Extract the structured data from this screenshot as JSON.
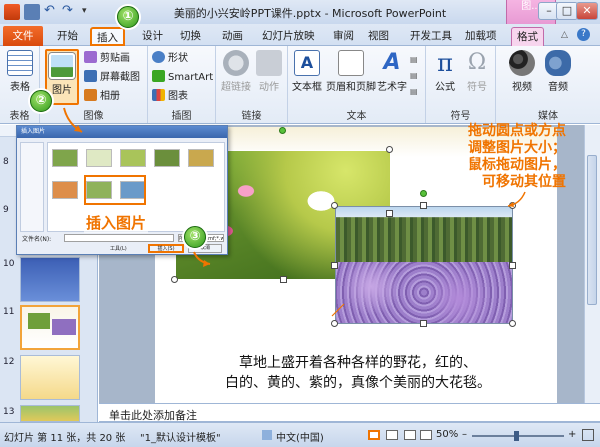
{
  "window": {
    "title": "美丽的小兴安岭PPT课件.pptx - Microsoft PowerPoint",
    "context_group": "图...",
    "minimize": "–",
    "maximize": "□",
    "close": "✕"
  },
  "tabs": {
    "file": "文件",
    "items": [
      "开始",
      "插入",
      "设计",
      "切换",
      "动画",
      "幻灯片放映",
      "审阅",
      "视图",
      "开发工具",
      "加载项"
    ],
    "format": "格式"
  },
  "ribbon": {
    "table_group": {
      "label": "表格",
      "table_btn": "表格"
    },
    "image_group": {
      "label": "图像",
      "picture_btn": "图片",
      "clipart_btn": "剪贴画",
      "screenshot_btn": "屏幕截图",
      "album_btn": "相册"
    },
    "illustration_group": {
      "label": "插图",
      "shapes_btn": "形状",
      "smartart_btn": "SmartArt",
      "chart_btn": "图表"
    },
    "links_group": {
      "label": "链接",
      "hyperlink_btn": "超链接",
      "action_btn": "动作"
    },
    "text_group": {
      "label": "文本",
      "textbox_btn": "文本框",
      "header_btn": "页眉和页脚",
      "wordart_btn": "艺术字",
      "more_btn": ""
    },
    "symbol_group": {
      "label": "符号",
      "formula_btn": "公式",
      "symbol_btn": "符号"
    },
    "media_group": {
      "label": "媒体",
      "video_btn": "视频",
      "audio_btn": "音频"
    }
  },
  "slides": {
    "numbers": [
      "8",
      "9",
      "10",
      "11",
      "12",
      "13"
    ]
  },
  "dialog": {
    "title": "插入图片",
    "filename_label": "文件名(N):",
    "filetype_label": "所有图片(*.emf;*.wmf;...",
    "tools_label": "工具(L)",
    "insert_btn": "插入(S)",
    "cancel_btn": "取消"
  },
  "annotations": {
    "step1": "①",
    "step2": "②",
    "step3": "③",
    "insert_picture": "插入图片",
    "tip_line1": "拖动圆点或方点",
    "tip_line2": "调整图片大小；",
    "tip_line3": "鼠标拖动图片，",
    "tip_line4": "可移动其位置"
  },
  "slide_content": {
    "text_line1": "草地上盛开着各种各样的野花，红的、",
    "text_line2": "白的、黄的、紫的，真像个美丽的大花毯。"
  },
  "notes": {
    "placeholder": "单击此处添加备注"
  },
  "status": {
    "slide_info": "幻灯片 第 11 张，共 20 张",
    "theme": "\"1_默认设计模板\"",
    "language": "中文(中国)",
    "zoom": "50%",
    "zoom_minus": "–",
    "zoom_plus": "+"
  },
  "colors": {
    "accent": "#f07400",
    "file_tab": "#e0520f",
    "format_tab": "#e89ad4",
    "badge_green": "#3aa623"
  }
}
